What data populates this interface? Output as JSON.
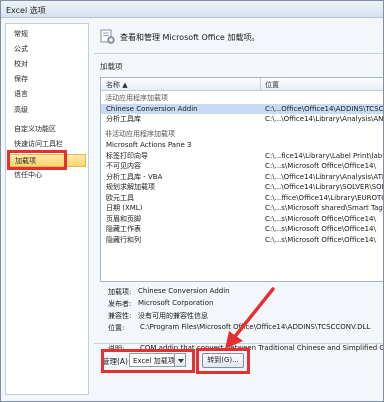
{
  "window": {
    "title": "Excel 选项"
  },
  "sidebar": {
    "items": [
      {
        "label": "常规"
      },
      {
        "label": "公式"
      },
      {
        "label": "校对"
      },
      {
        "label": "保存"
      },
      {
        "label": "语言"
      },
      {
        "label": "高级"
      },
      {
        "label": "自定义功能区"
      },
      {
        "label": "快速访问工具栏"
      },
      {
        "label": "加载项"
      },
      {
        "label": "信任中心"
      }
    ],
    "active": "加载项"
  },
  "main": {
    "header": "查看和管理 Microsoft Office 加载项。",
    "section_title": "加载项",
    "columns": {
      "name": "名称 ▲",
      "location": "位置"
    }
  },
  "addins": {
    "active_group": "活动应用程序加载项",
    "active_items": [
      {
        "name": "Chinese Conversion Addin",
        "location": "C:\\...Office\\Office14\\ADDINS\\TCSC"
      },
      {
        "name": "分析工具库",
        "location": "C:\\...\\Office14\\Library\\Analysis\\AN"
      }
    ],
    "inactive_group": "非活动应用程序加载项",
    "inactive_items": [
      {
        "name": "Microsoft Actions Pane 3",
        "location": ""
      },
      {
        "name": "标签打印向导",
        "location": "C:\\...fice14\\Library\\Label Print\\lab"
      },
      {
        "name": "不可见内容",
        "location": "C:\\...s\\Microsoft Office\\Office14\\"
      },
      {
        "name": "分析工具库 - VBA",
        "location": "C:\\...\\Office14\\Library\\Analysis\\ATPVB"
      },
      {
        "name": "规划求解加载项",
        "location": "C:\\...\\Office14\\Library\\SOLVER\\SOL"
      },
      {
        "name": "欧元工具",
        "location": "C:\\...ffice\\Office14\\Library\\EUROTO"
      },
      {
        "name": "日期 (XML)",
        "location": "C:\\...s\\Microsoft shared\\Smart Tag\\"
      },
      {
        "name": "页眉和页脚",
        "location": "C:\\...s\\Microsoft Office\\Office14\\"
      },
      {
        "name": "隐藏工作表",
        "location": "C:\\...s\\Microsoft Office\\Office14\\"
      },
      {
        "name": "隐藏行和列",
        "location": "C:\\...s\\Microsoft Office\\Office14\\"
      }
    ]
  },
  "details": {
    "addin_label": "加载项:",
    "addin_value": "Chinese Conversion Addin",
    "publisher_label": "发布者:",
    "publisher_value": "Microsoft Corporation",
    "compat_label": "兼容性:",
    "compat_value": "没有可用的兼容性信息",
    "location_label": "位置:",
    "location_value": "C:\\Program Files\\Microsoft Office\\Office14\\ADDINS\\TCSCCONV.DLL",
    "desc_label": "说明:",
    "desc_value": "COM addin that convert between Traditional Chinese and Simplified Ch"
  },
  "manage": {
    "label": "管理(A):",
    "selected": "Excel 加载项",
    "go_button": "转到(G)..."
  },
  "colors": {
    "highlight": "#f9d772",
    "callout_red": "#e43030",
    "selection": "#c7dcf4"
  }
}
